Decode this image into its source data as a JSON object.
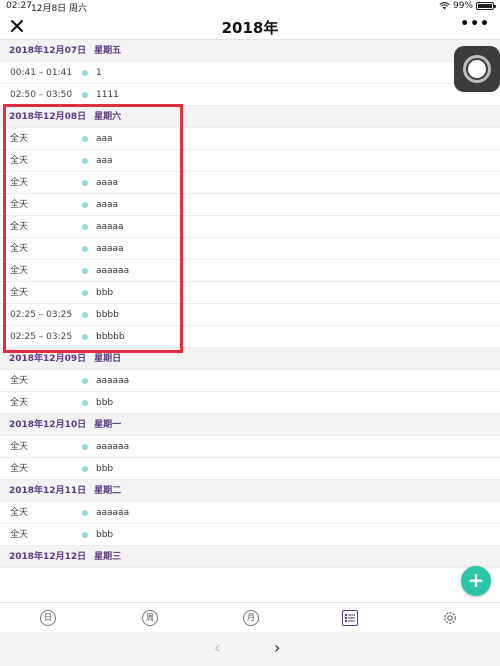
{
  "status_bar": {
    "time": "02:27",
    "date": "12月8日 周六",
    "battery": "99%"
  },
  "nav": {
    "title": "2018年",
    "more": "•••"
  },
  "sections": [
    {
      "date": "2018年12月07日",
      "weekday": "星期五",
      "items": [
        {
          "time": "00:41 – 01:41",
          "name": "1"
        },
        {
          "time": "02:50 – 03:50",
          "name": "1111"
        }
      ]
    },
    {
      "date": "2018年12月08日",
      "weekday": "星期六",
      "items": [
        {
          "time": "全天",
          "name": "aaa"
        },
        {
          "time": "全天",
          "name": "aaa"
        },
        {
          "time": "全天",
          "name": "aaaa"
        },
        {
          "time": "全天",
          "name": "aaaa"
        },
        {
          "time": "全天",
          "name": "aaaaa"
        },
        {
          "time": "全天",
          "name": "aaaaa"
        },
        {
          "time": "全天",
          "name": "aaaaaa"
        },
        {
          "time": "全天",
          "name": "bbb"
        },
        {
          "time": "02:25 – 03:25",
          "name": "bbbb"
        },
        {
          "time": "02:25 – 03:25",
          "name": "bbbbb"
        }
      ]
    },
    {
      "date": "2018年12月09日",
      "weekday": "星期日",
      "items": [
        {
          "time": "全天",
          "name": "aaaaaa"
        },
        {
          "time": "全天",
          "name": "bbb"
        }
      ]
    },
    {
      "date": "2018年12月10日",
      "weekday": "星期一",
      "items": [
        {
          "time": "全天",
          "name": "aaaaaa"
        },
        {
          "time": "全天",
          "name": "bbb"
        }
      ]
    },
    {
      "date": "2018年12月11日",
      "weekday": "星期二",
      "items": [
        {
          "time": "全天",
          "name": "aaaaaa"
        },
        {
          "time": "全天",
          "name": "bbb"
        }
      ]
    },
    {
      "date": "2018年12月12日",
      "weekday": "星期三",
      "items": []
    }
  ],
  "fab": "+",
  "tabs": {
    "day": "日",
    "week": "周",
    "month": "月"
  },
  "footer": {
    "prev": "‹",
    "next": "›"
  },
  "colors": {
    "accent": "#5b3a82",
    "dot": "#9ad6db",
    "fab": "#2ec4a8",
    "highlight": "#e0303f"
  }
}
